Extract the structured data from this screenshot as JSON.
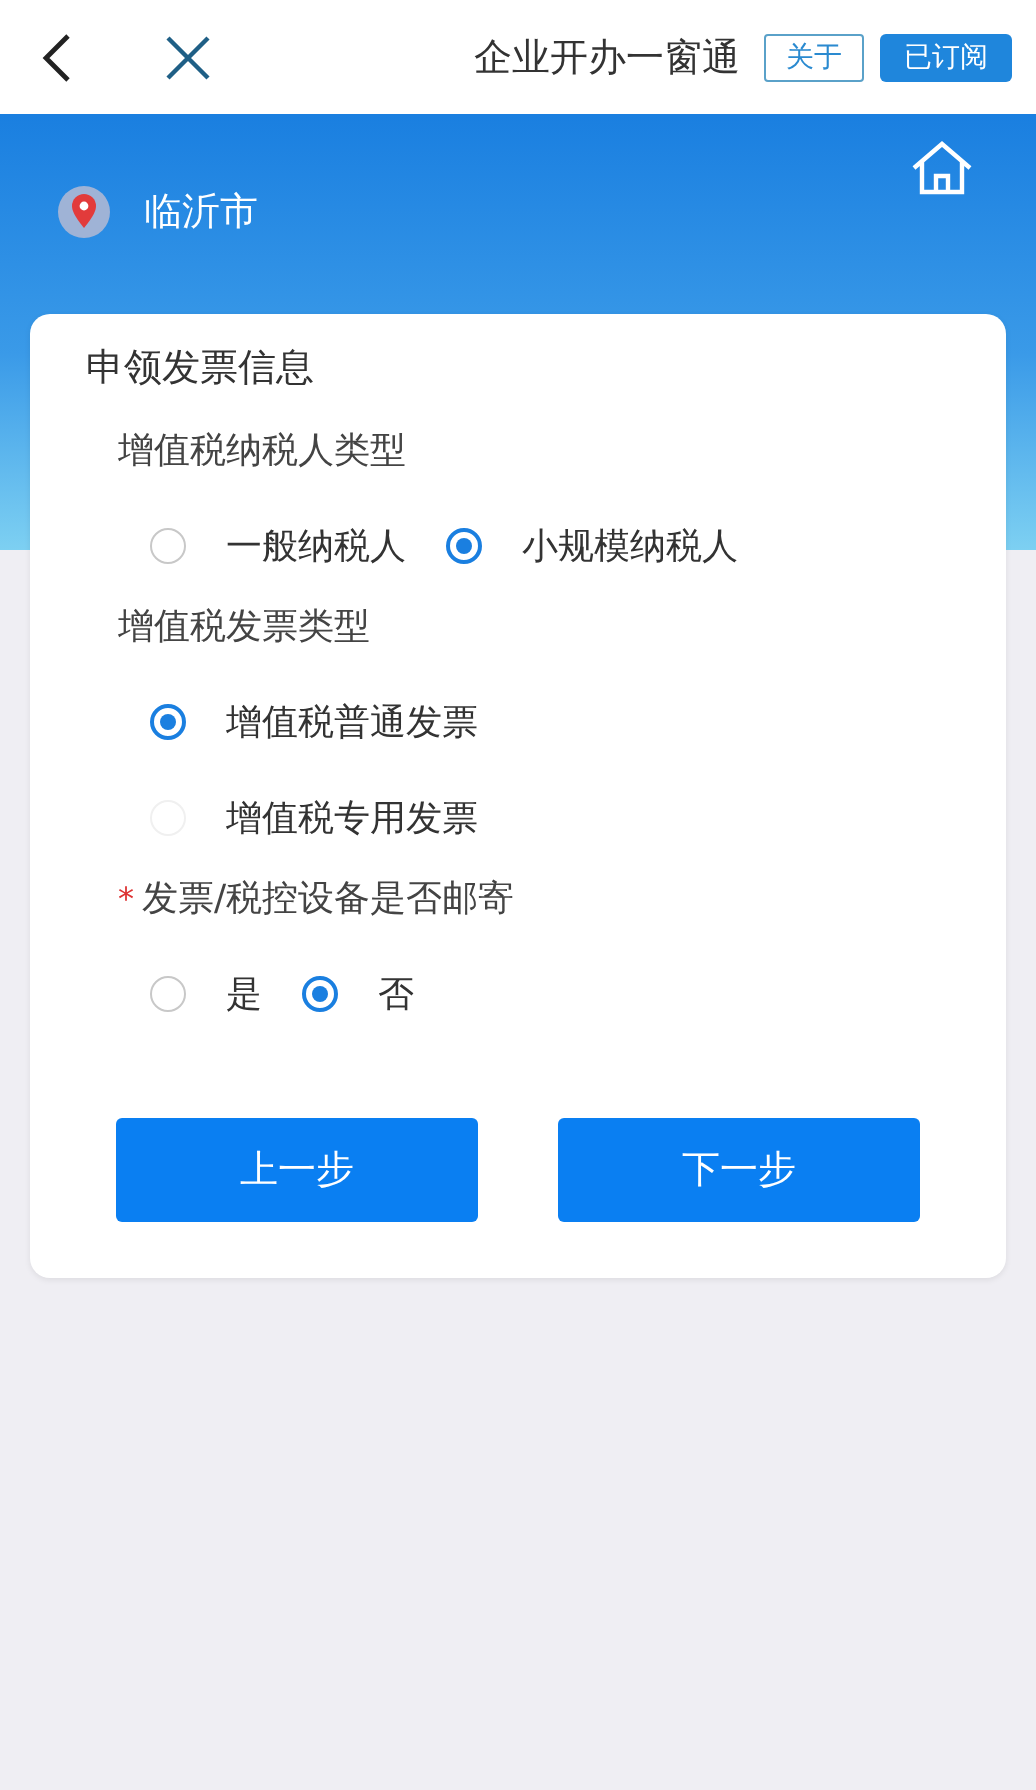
{
  "header": {
    "title": "企业开办一窗通",
    "about_button": "关于",
    "subscribe_button": "已订阅"
  },
  "location": {
    "city": "临沂市"
  },
  "card": {
    "title": "申领发票信息",
    "groups": [
      {
        "label": "增值税纳税人类型",
        "kind": "inline",
        "options": [
          {
            "label": "一般纳税人",
            "selected": false,
            "disabled": false
          },
          {
            "label": "小规模纳税人",
            "selected": true,
            "disabled": false
          }
        ]
      },
      {
        "label": "增值税发票类型",
        "kind": "stacked",
        "options": [
          {
            "label": "增值税普通发票",
            "selected": true,
            "disabled": false
          },
          {
            "label": "增值税专用发票",
            "selected": false,
            "disabled": true
          }
        ]
      },
      {
        "label": "发票/税控设备是否邮寄",
        "required_mark": "*",
        "kind": "inline",
        "options": [
          {
            "label": "是",
            "selected": false,
            "disabled": false
          },
          {
            "label": "否",
            "selected": true,
            "disabled": false
          }
        ]
      }
    ],
    "buttons": [
      "上一步",
      "下一步"
    ]
  }
}
